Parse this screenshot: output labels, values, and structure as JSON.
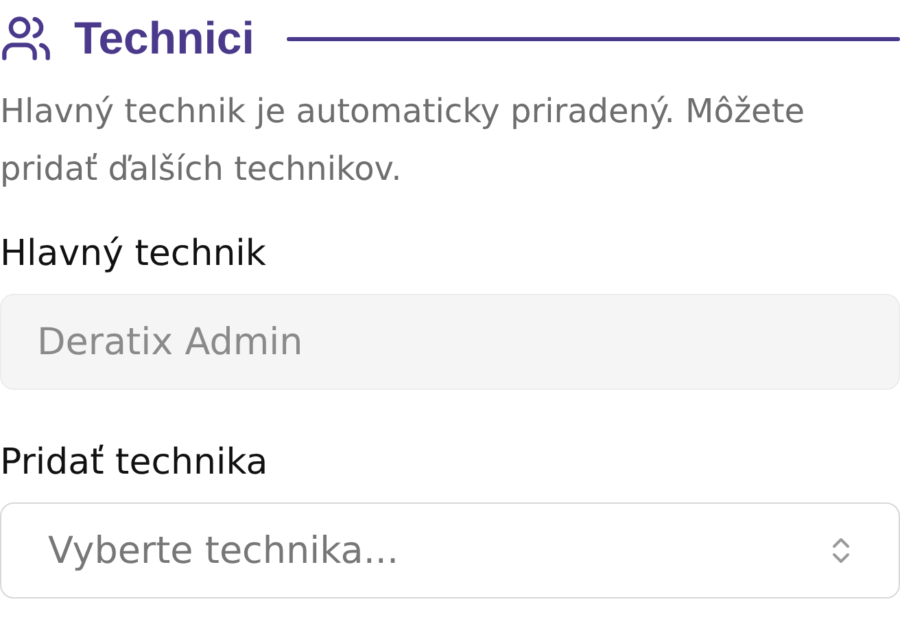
{
  "section": {
    "title": "Technici",
    "description": "Hlavný technik je automaticky priradený. Môžete pridať ďalších technikov."
  },
  "fields": [
    {
      "kind": "text",
      "label": "Hlavný technik",
      "value": "Deratix Admin",
      "disabled": true
    },
    {
      "kind": "select",
      "label": "Pridať technika",
      "placeholder": "Vyberte technika...",
      "disabled": false
    }
  ]
}
